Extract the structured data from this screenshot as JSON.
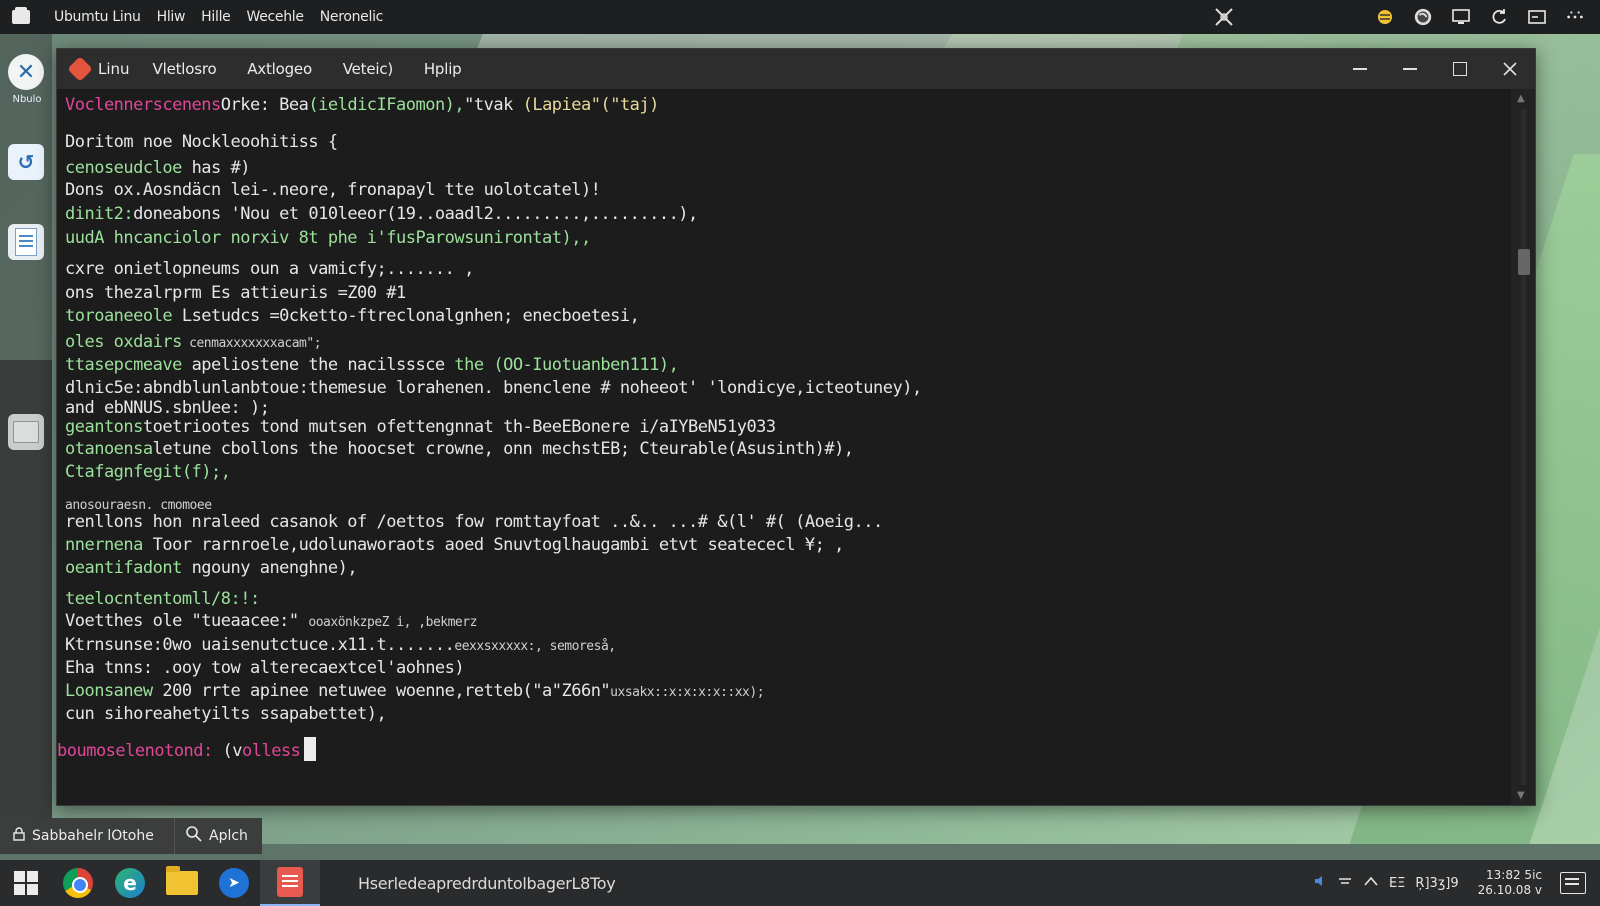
{
  "top_panel": {
    "menu": [
      "Ubumtu Linu",
      "Hliw",
      "Hille",
      "Wecehle",
      "Neronelic"
    ],
    "icons": [
      "close-x-icon",
      "bee-icon",
      "globe-icon",
      "display-icon",
      "refresh-icon",
      "window-icon",
      "more-icon"
    ]
  },
  "dock": {
    "item1_label": "Nbulo"
  },
  "window": {
    "app_title": "Linu",
    "menu": [
      "Vletlosro",
      "Axtlogeo",
      "Veteic)",
      "Hplip"
    ],
    "controls": [
      "minimize",
      "minimize2",
      "maximize",
      "close"
    ]
  },
  "terminal": {
    "header": {
      "part1": "Voclennerscenens",
      "part2": "Orke: Bea",
      "part3": "(ieldicIFaomon),",
      "part4": "\"tvak",
      "part5": "(Lapiea\"(\"taj)"
    },
    "lines": [
      {
        "a": "Doritom noe Nockleoohitiss {",
        "b": "",
        "c": ""
      },
      {
        "a": "cenoseudcloe",
        "b": " has #)",
        "c": ""
      },
      {
        "a": "Dons ox.Aosndäcn lei-.neore, fronapayl tte uolotcatel)!",
        "b": "",
        "c": ""
      },
      {
        "a": "dinit2:",
        "b": "doneabons 'Nou et 010leeor(19..oaadl2.........,.........),",
        "c": ""
      },
      {
        "a": "uudA hncanciolor norxiv 8t phe i'fusParowsunirontat),,",
        "b": "",
        "c": ""
      },
      {
        "a": "cxre onietlopneums oun a vamicfy;....... ,",
        "b": "",
        "c": ""
      },
      {
        "a": "ons thezalrprm Es attieuris =Z00 #1",
        "b": "",
        "c": ""
      },
      {
        "a": "toroaneeole",
        "b": " Lsetudcs =0cketto-ftreclonalgnhen; enecboetesi,",
        "c": ""
      },
      {
        "a": "oles oxdairs",
        "b": " cenmaxxxxxxxacam\";",
        "c": ""
      },
      {
        "a": "ttasepcmeave",
        "b": " apeliostene the nacilsssce ",
        "c": "the (OO-Iuotuanben111),"
      },
      {
        "a": "dlnic5e:",
        "b": "abndblunlanbtoue:themesue lorahenen. bnenclene # noheeot' 'londicye,icteotuney),",
        "c": ""
      },
      {
        "a": "and ebNNUS.sbnUee: );",
        "b": "",
        "c": ""
      },
      {
        "a": "geantons",
        "b": "toetriootes tond mutsen ofettengnnat th-BeeEBonere i/aIYBeN51y033",
        "c": ""
      },
      {
        "a": "otanoensa",
        "b": "letune cbollons the hoocset crowne, onn mechstEB; Cteurable(Asusinth)#),",
        "c": ""
      },
      {
        "a": "Ctafagnfegit(f);,",
        "b": "",
        "c": ""
      },
      {
        "a": "anosouraesn. cmomoee",
        "b": "",
        "c": ""
      },
      {
        "a": "renllons hon nraleed casanok of /oettos fow romttayfoat ..&.. ...# &(l' #( (Aoeig...",
        "b": "",
        "c": ""
      },
      {
        "a": "nnernena",
        "b": " Toor rarnroele,udolunaworaots aoed Snuvtoglhaugambi etvt seatececl ¥; ,",
        "c": ""
      },
      {
        "a": "oeantifadont",
        "b": " ngouny anenghne),",
        "c": ""
      },
      {
        "a": "teelocntentomll/8:!:",
        "b": "",
        "c": ""
      },
      {
        "a": "Voetthes ole \"tueaacee:\"",
        "b": "",
        "c": "ooaxönkzpeZ i, ,bekmerz"
      },
      {
        "a": "Ktrnsunse:",
        "b": "0wo uaisenutctuce.x11.t.......",
        "c": "eexxsxxxxx:, semoreså,"
      },
      {
        "a": "Eha tnns: .ooy tow alterecaextcel'aohnes)",
        "b": "",
        "c": ""
      },
      {
        "a": "Loonsanew",
        "b": " 200 rrte apinee netuwee woenne,retteb(\"a\"Z66n\"",
        "c": "uxsakx::x:x:x:x::xx);"
      },
      {
        "a": "cun sihoreahetyilts ssapabettet),",
        "b": "",
        "c": ""
      }
    ],
    "prompt": {
      "user": "boumoselenotond:",
      "arg": " (v",
      "arg2": "olless"
    }
  },
  "search_area": {
    "left_label": "Sabbahelr lOtohe",
    "right_label": "Aplch"
  },
  "taskbar": {
    "active_title": "HserledeapredrduntolbagerL8Toy",
    "tray": [
      "speaker-icon",
      "network-icon",
      "chevron-up-icon",
      "keyboard-icon",
      "ime-icon"
    ],
    "tray_text1": "ΕΞ",
    "tray_text2": "Ŗ]3ʒ]9",
    "clock_time": "13:82 5ic",
    "clock_date": "26.10.08 v"
  }
}
